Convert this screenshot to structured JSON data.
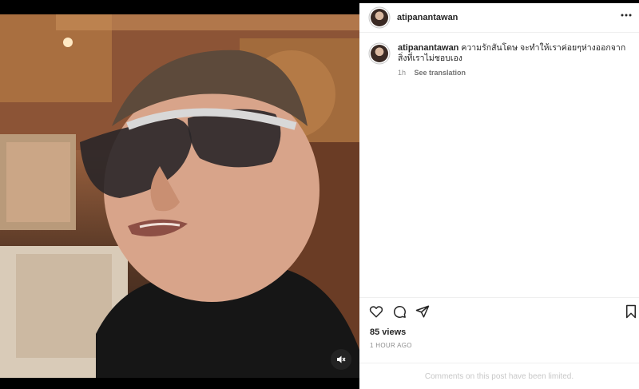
{
  "post": {
    "username": "atipanantawan",
    "caption": "ความรักสันโดษ จะทำให้เราค่อยๆห่างออกจากสิ่งที่เราไม่ชอบเอง",
    "time_short": "1h",
    "see_translation": "See translation",
    "views": "85 views",
    "time_long": "1 HOUR AGO",
    "comments_limited": "Comments on this post have been limited."
  },
  "icons": {
    "more": "more-horizontal-icon",
    "like": "heart-icon",
    "comment": "comment-icon",
    "share": "send-icon",
    "save": "bookmark-icon",
    "mute": "speaker-muted-icon"
  },
  "colors": {
    "text_primary": "#262626",
    "text_secondary": "#8e8e8e",
    "divider": "#efefef",
    "muted_text": "#c7c7c7"
  }
}
